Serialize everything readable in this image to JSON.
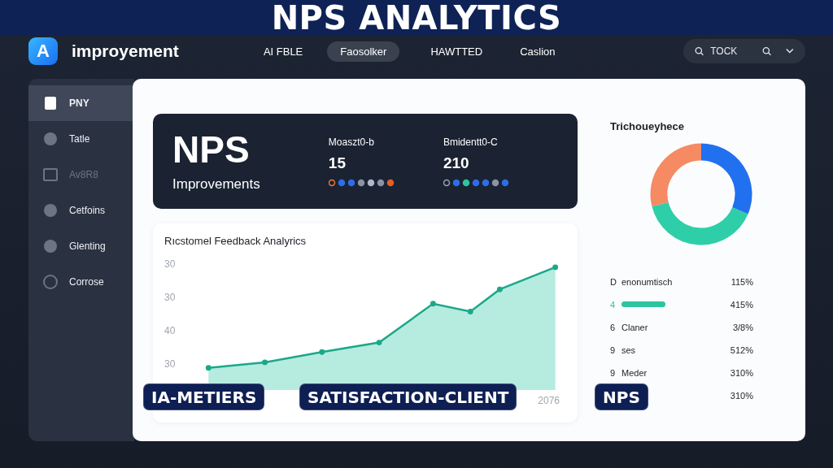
{
  "banner": {
    "title": "NPS ANALYTICS"
  },
  "header": {
    "logo": "A",
    "title": "improyement",
    "nav": [
      {
        "label": "AI FBLE",
        "selected": false
      },
      {
        "label": "Faosolker",
        "selected": true
      },
      {
        "label": "HAWTTED",
        "selected": false
      },
      {
        "label": "Caslion",
        "selected": false
      }
    ],
    "search": {
      "value": "TOCK"
    }
  },
  "sidebar": {
    "items": [
      {
        "label": "PNY",
        "selected": true,
        "disabled": false
      },
      {
        "label": "Tatle",
        "selected": false,
        "disabled": false
      },
      {
        "label": "Av8R8",
        "selected": false,
        "disabled": true
      },
      {
        "label": "Cetfoins",
        "selected": false,
        "disabled": false
      },
      {
        "label": "Glenting",
        "selected": false,
        "disabled": false
      },
      {
        "label": "Corrose",
        "selected": false,
        "disabled": false
      }
    ]
  },
  "hero": {
    "title": "NPS",
    "subtitle": "Improvements",
    "stats": [
      {
        "label": "Moaszt0-b",
        "value": "15"
      },
      {
        "label": "Bmidentt0-C",
        "value": "210"
      }
    ]
  },
  "chart": {
    "title": "Rıcstomel Feedback Analyrics",
    "y_labels": [
      "30",
      "30",
      "40",
      "30"
    ],
    "x_labels": [
      "2076"
    ]
  },
  "breakdown": {
    "title": "Trichoueyhece",
    "rows": [
      {
        "kind": "text",
        "number": "D",
        "label": "enonumtisch",
        "percent": "115%"
      },
      {
        "kind": "bar",
        "number": "4",
        "percent": "415%"
      },
      {
        "kind": "text",
        "number": "6",
        "label": "Claner",
        "percent": "3/8%"
      },
      {
        "kind": "text",
        "number": "9",
        "label": "ses",
        "percent": "512%"
      },
      {
        "kind": "text",
        "number": "9",
        "label": "Meder",
        "percent": "310%"
      },
      {
        "kind": "hidden",
        "percent": "310%"
      }
    ]
  },
  "tags": [
    "IA-METIERS",
    "SATISFACTION-CLIENT",
    "NPS"
  ]
}
